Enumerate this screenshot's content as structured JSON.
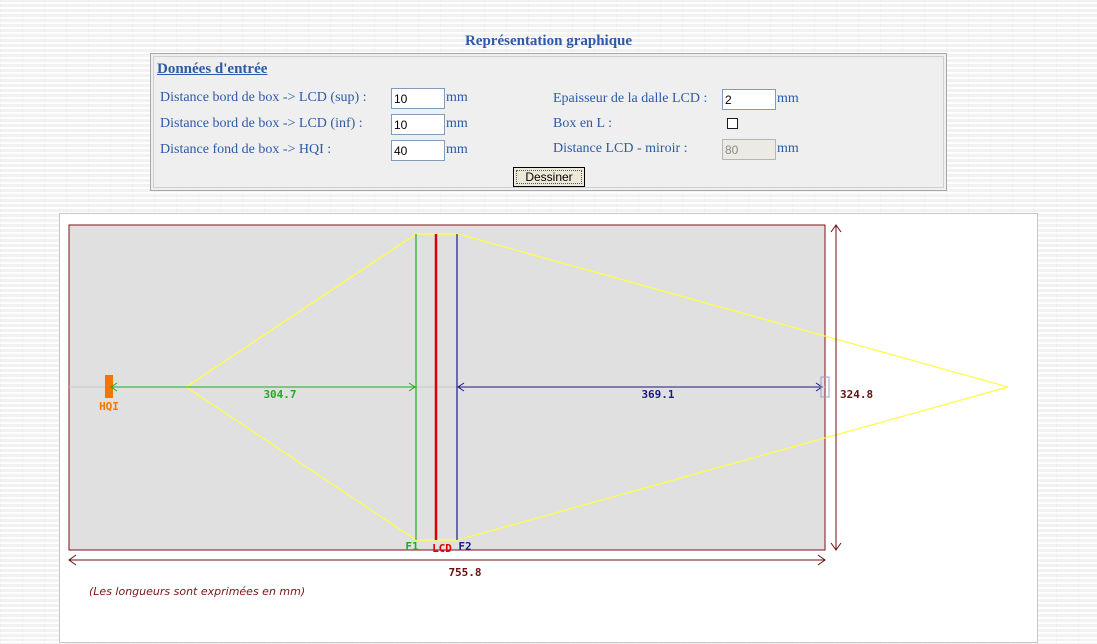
{
  "page": {
    "title": "Représentation graphique"
  },
  "form": {
    "legend": "Données d'entrée",
    "fields": {
      "dist_sup_label": "Distance bord de box -> LCD (sup) :",
      "dist_sup_value": "10",
      "dist_sup_unit": "mm",
      "dist_inf_label": "Distance bord de box -> LCD (inf) :",
      "dist_inf_value": "10",
      "dist_inf_unit": "mm",
      "dist_hqi_label": "Distance fond de box -> HQI :",
      "dist_hqi_value": "40",
      "dist_hqi_unit": "mm",
      "epaisseur_label": "Epaisseur de la dalle LCD :",
      "epaisseur_value": "2",
      "epaisseur_unit": "mm",
      "box_en_l_label": "Box en L :",
      "box_en_l_checked": false,
      "dist_miroir_label": "Distance LCD - miroir :",
      "dist_miroir_value": "80",
      "dist_miroir_unit": "mm"
    },
    "draw_button_label": "Dessiner"
  },
  "drawing": {
    "labels": {
      "hqi": "HQI",
      "f1": "F1",
      "lcd": "LCD",
      "f2": "F2"
    },
    "dimensions": {
      "hqi_to_f1": "304.7",
      "f2_to_end": "369.1",
      "height": "324.8",
      "width": "755.8"
    },
    "note": "(Les longueurs sont exprimées en mm)",
    "colors": {
      "box_fill": "#e0e0e0",
      "box_border": "#7a1515",
      "hqi": "#f07800",
      "f1": "#22aa22",
      "lcd": "#dd0000",
      "f2": "#1a1a99",
      "rays": "#ffff44",
      "dimension_dark": "#6b0f0f",
      "dimension_green": "#22aa22",
      "dimension_blue": "#1a1a80",
      "note": "#7a1515"
    }
  }
}
